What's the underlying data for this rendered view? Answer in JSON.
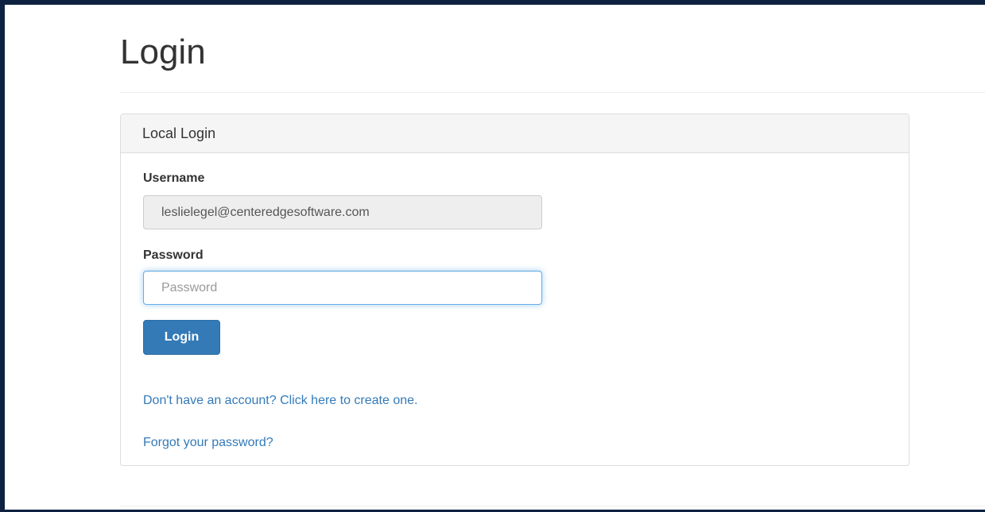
{
  "page": {
    "title": "Login"
  },
  "panel": {
    "heading": "Local Login"
  },
  "form": {
    "username_label": "Username",
    "username_value": "leslielegel@centeredgesoftware.com",
    "password_label": "Password",
    "password_placeholder": "Password",
    "password_value": "",
    "submit_label": "Login"
  },
  "links": {
    "create_account": "Don't have an account? Click here to create one.",
    "forgot_password": "Forgot your password?"
  },
  "colors": {
    "frame": "#0d2240",
    "primary": "#337ab7",
    "focus_border": "#66afe9",
    "panel_heading_bg": "#f5f5f5",
    "readonly_bg": "#eeeeee"
  }
}
